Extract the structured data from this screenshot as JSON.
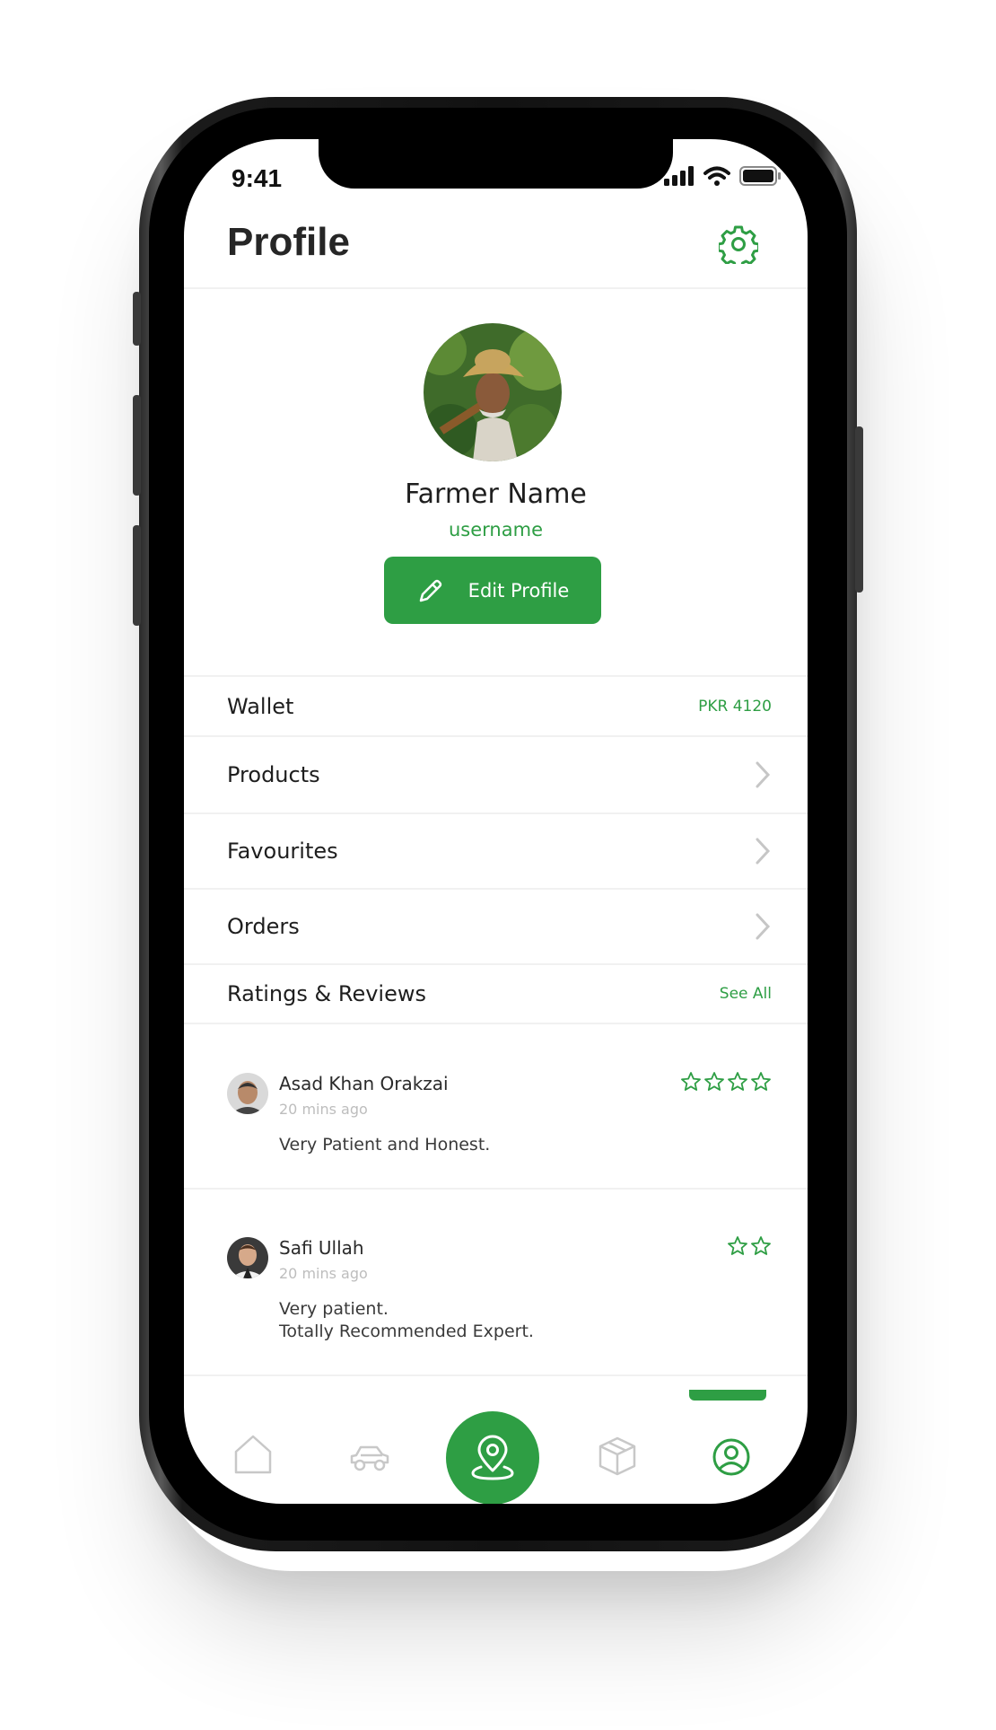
{
  "status_bar": {
    "time": "9:41"
  },
  "header": {
    "title": "Profile"
  },
  "profile": {
    "name": "Farmer Name",
    "username": "username",
    "edit_label": "Edit Profile"
  },
  "menu": {
    "wallet": {
      "label": "Wallet",
      "value": "PKR 4120"
    },
    "items": [
      {
        "label": "Products"
      },
      {
        "label": "Favourites"
      },
      {
        "label": "Orders"
      }
    ],
    "ratings": {
      "label": "Ratings & Reviews",
      "link": "See All"
    }
  },
  "reviews": [
    {
      "name": "Asad Khan Orakzai",
      "time": "20 mins ago",
      "text": "Very Patient and Honest.",
      "stars": 4
    },
    {
      "name": "Safi Ullah",
      "time": "20 mins ago",
      "text_line1": "Very patient.",
      "text_line2": "Totally Recommended Expert.",
      "stars": 2
    }
  ],
  "tabs": [
    {
      "icon": "home-icon"
    },
    {
      "icon": "car-icon"
    },
    {
      "icon": "location-pin-icon"
    },
    {
      "icon": "box-icon"
    },
    {
      "icon": "user-circle-icon"
    }
  ],
  "colors": {
    "accent": "#2e9e44",
    "text": "#1e1e1e",
    "muted": "#bdbdbd"
  }
}
